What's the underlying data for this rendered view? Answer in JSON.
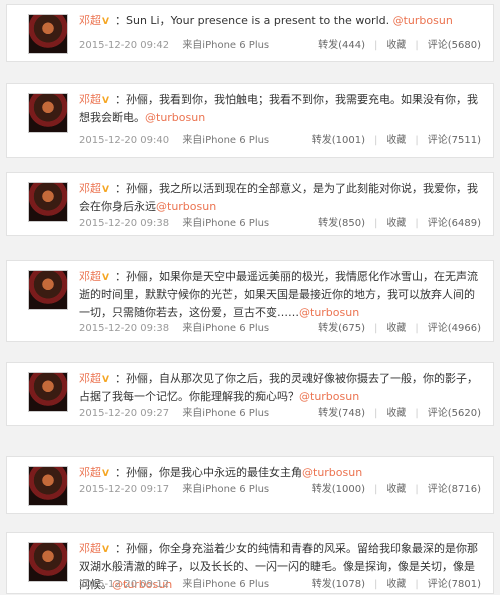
{
  "posts": [
    {
      "author": "邓超",
      "text": "：Sun Li，Your presence is a present to the world.",
      "mention": "@turbosun",
      "time": "2015-12-20 09:42",
      "source": "来自iPhone 6 Plus",
      "repost": "转发(444)",
      "favorite": "收藏",
      "comment": "评论(5680)"
    },
    {
      "author": "邓超",
      "text": "：孙俪，我看到你，我怕触电；我看不到你，我需要充电。如果没有你，我想我会断电。",
      "mention": "@turbosun",
      "time": "2015-12-20 09:40",
      "source": "来自iPhone 6 Plus",
      "repost": "转发(1001)",
      "favorite": "收藏",
      "comment": "评论(7511)"
    },
    {
      "author": "邓超",
      "text": "：孙俪，我之所以活到现在的全部意义，是为了此刻能对你说，我爱你，我会在你身后永远",
      "mention": "@turbosun",
      "time": "2015-12-20 09:38",
      "source": "来自iPhone 6 Plus",
      "repost": "转发(850)",
      "favorite": "收藏",
      "comment": "评论(6489)"
    },
    {
      "author": "邓超",
      "text": "：孙俪，如果你是天空中最遥远美丽的极光，我情愿化作冰雪山，在无声流逝的时间里，默默守候你的光芒，如果天国是最接近你的地方，我可以放弃人间的一切，只需随你若去，这份爱，亘古不变……",
      "mention": "@turbosun",
      "time": "2015-12-20 09:38",
      "source": "来自iPhone 6 Plus",
      "repost": "转发(675)",
      "favorite": "收藏",
      "comment": "评论(4966)"
    },
    {
      "author": "邓超",
      "text": "：孙俪，自从那次见了你之后，我的灵魂好像被你摄去了一般，你的影子，占据了我每一个记忆。你能理解我的痴心吗？",
      "mention": "@turbosun",
      "time": "2015-12-20 09:27",
      "source": "来自iPhone 6 Plus",
      "repost": "转发(748)",
      "favorite": "收藏",
      "comment": "评论(5620)"
    },
    {
      "author": "邓超",
      "text": "：孙俪，你是我心中永远的最佳女主角",
      "mention": "@turbosun",
      "time": "2015-12-20 09:17",
      "source": "来自iPhone 6 Plus",
      "repost": "转发(1000)",
      "favorite": "收藏",
      "comment": "评论(8716)"
    },
    {
      "author": "邓超",
      "text": "：孙俪，你全身充溢着少女的纯情和青春的风采。留给我印象最深的是你那双湖水般清澈的眸子，以及长长的、一闪一闪的睫毛。像是探询，像是关切，像是问候。",
      "mention": "@turbosun",
      "time": "2015-12-20 09:12",
      "source": "来自iPhone 6 Plus",
      "repost": "转发(1078)",
      "favorite": "收藏",
      "comment": "评论(7801)"
    }
  ],
  "colors": {
    "accent": "#eb7350",
    "meta": "#999999",
    "vip_badge": "#f5a623"
  }
}
